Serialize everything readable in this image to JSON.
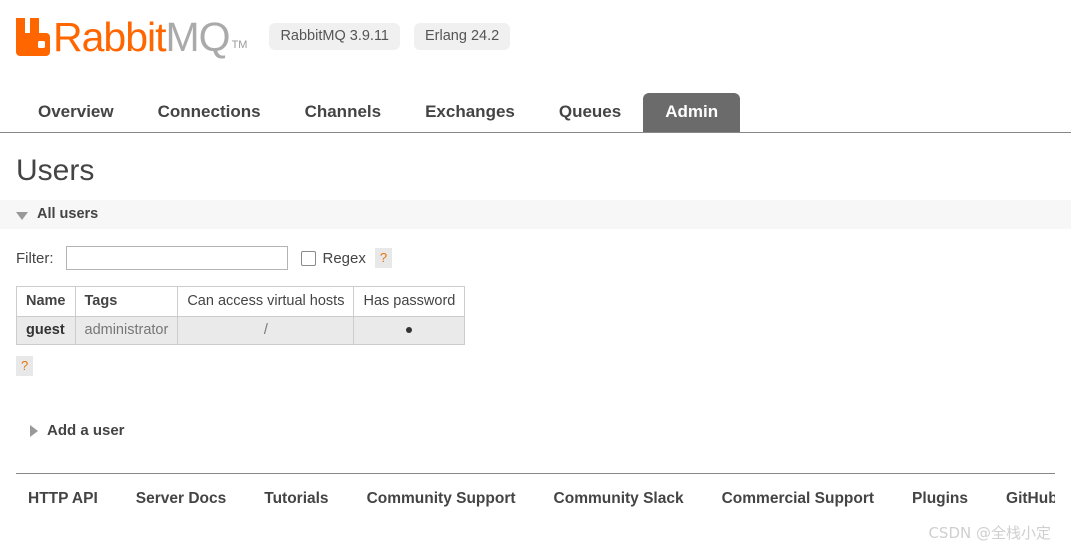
{
  "header": {
    "logo": {
      "mark": "rabbitmq-logo-mark",
      "text_primary": "Rabbit",
      "text_secondary": "MQ",
      "trademark": "TM",
      "color_primary": "#ff6600",
      "color_secondary": "#aaaaaa"
    },
    "versions": [
      {
        "label": "RabbitMQ 3.9.11"
      },
      {
        "label": "Erlang 24.2"
      }
    ]
  },
  "nav": {
    "tabs": [
      {
        "label": "Overview",
        "active": false
      },
      {
        "label": "Connections",
        "active": false
      },
      {
        "label": "Channels",
        "active": false
      },
      {
        "label": "Exchanges",
        "active": false
      },
      {
        "label": "Queues",
        "active": false
      },
      {
        "label": "Admin",
        "active": true
      }
    ],
    "active_color": "#6b6b6b"
  },
  "main": {
    "page_title": "Users",
    "all_users_section": {
      "label": "All users",
      "expanded": true,
      "toggle_icon": "triangle-down-icon"
    },
    "filter": {
      "label": "Filter:",
      "value": "",
      "placeholder": "",
      "regex_label": "Regex",
      "regex_checked": false,
      "help_label": "?"
    },
    "table": {
      "columns": [
        {
          "label": "Name",
          "sortable": true,
          "align": "left"
        },
        {
          "label": "Tags",
          "sortable": true,
          "align": "left"
        },
        {
          "label": "Can access virtual hosts",
          "sortable": false,
          "align": "center"
        },
        {
          "label": "Has password",
          "sortable": false,
          "align": "center"
        }
      ],
      "rows": [
        {
          "name": "guest",
          "tags": "administrator",
          "vhosts": "/",
          "has_password": "•"
        }
      ]
    },
    "table_help_label": "?",
    "add_user_section": {
      "label": "Add a user",
      "expanded": false,
      "toggle_icon": "triangle-right-icon"
    }
  },
  "footer": {
    "links": [
      {
        "label": "HTTP API"
      },
      {
        "label": "Server Docs"
      },
      {
        "label": "Tutorials"
      },
      {
        "label": "Community Support"
      },
      {
        "label": "Community Slack"
      },
      {
        "label": "Commercial Support"
      },
      {
        "label": "Plugins"
      },
      {
        "label": "GitHub"
      }
    ]
  },
  "watermark": {
    "text": "CSDN @全栈小定"
  }
}
